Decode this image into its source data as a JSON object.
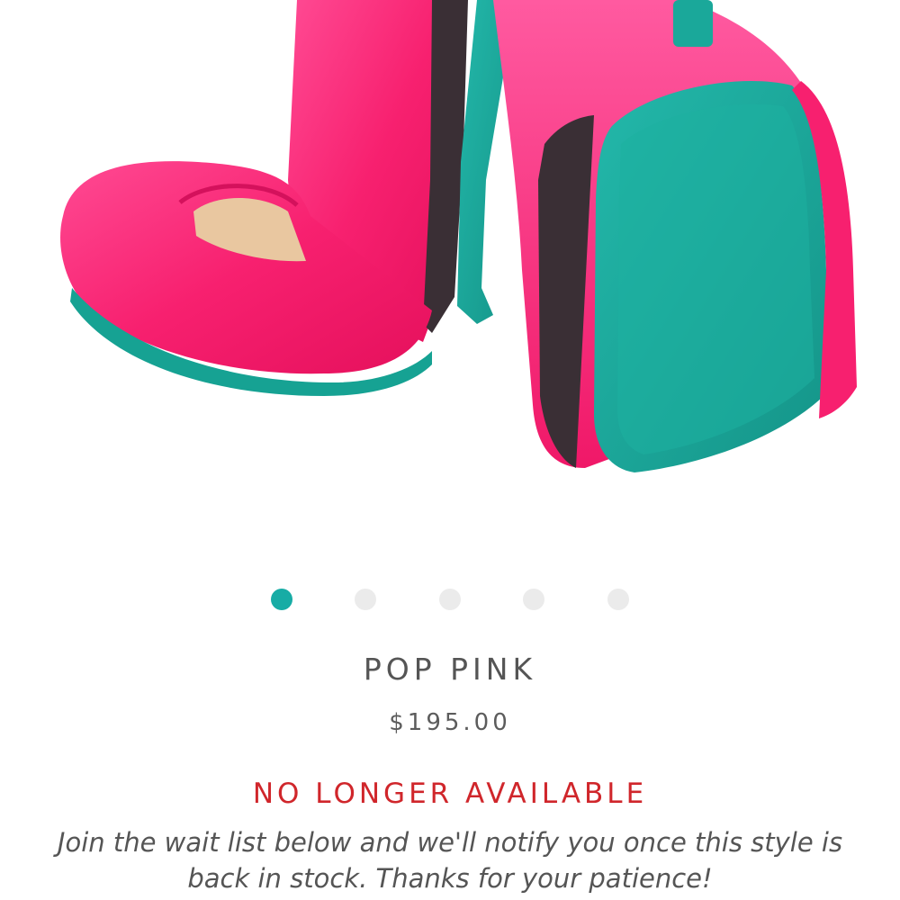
{
  "product": {
    "image_alt": "Pop Pink ballet flats with teal soles",
    "name": "POP PINK",
    "price": "$195.00",
    "availability": "NO LONGER AVAILABLE",
    "waitlist_message": "Join the wait list below and we'll notify you once this style is back in stock. Thanks for your patience!"
  },
  "carousel": {
    "active_index": 0,
    "total": 5
  },
  "colors": {
    "accent_teal": "#17aca5",
    "shoe_pink": "#f7206f",
    "sole_teal": "#1aa89a",
    "alert_red": "#d0262b",
    "inactive_dot": "#ebebeb"
  }
}
